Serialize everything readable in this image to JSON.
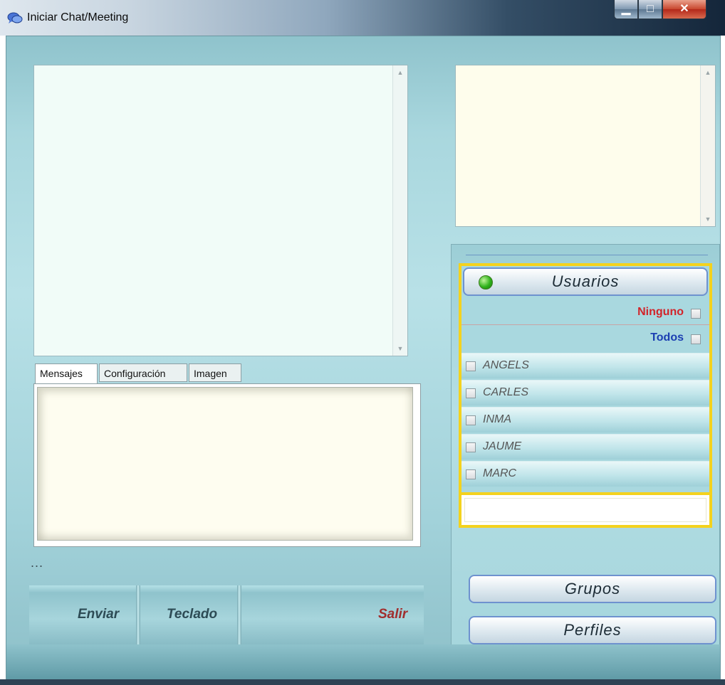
{
  "window": {
    "title": "Iniciar Chat/Meeting",
    "app_icon": "chat-app-icon",
    "controls": {
      "minimize": "minimize-icon",
      "maximize": "maximize-icon",
      "close": "close-icon"
    }
  },
  "tabs": [
    {
      "label": "Mensajes",
      "active": true
    },
    {
      "label": "Configuración",
      "active": false
    },
    {
      "label": "Imagen",
      "active": false
    }
  ],
  "status_text": "...",
  "buttons": {
    "send": "Enviar",
    "keyboard": "Teclado",
    "exit": "Salir"
  },
  "users_panel": {
    "header": "Usuarios",
    "status_color": "#2fb21b",
    "none_label": "Ninguno",
    "all_label": "Todos",
    "users": [
      "ANGELS",
      "CARLES",
      "INMA",
      "JAUME",
      "MARC"
    ]
  },
  "groups_button": "Grupos",
  "profiles_button": "Perfiles",
  "colors": {
    "accent_yellow": "#f4d21d",
    "none_red": "#d2242a",
    "all_blue": "#1c3fb2",
    "exit_red": "#a12e2e",
    "background_teal": "#a9d7de"
  }
}
